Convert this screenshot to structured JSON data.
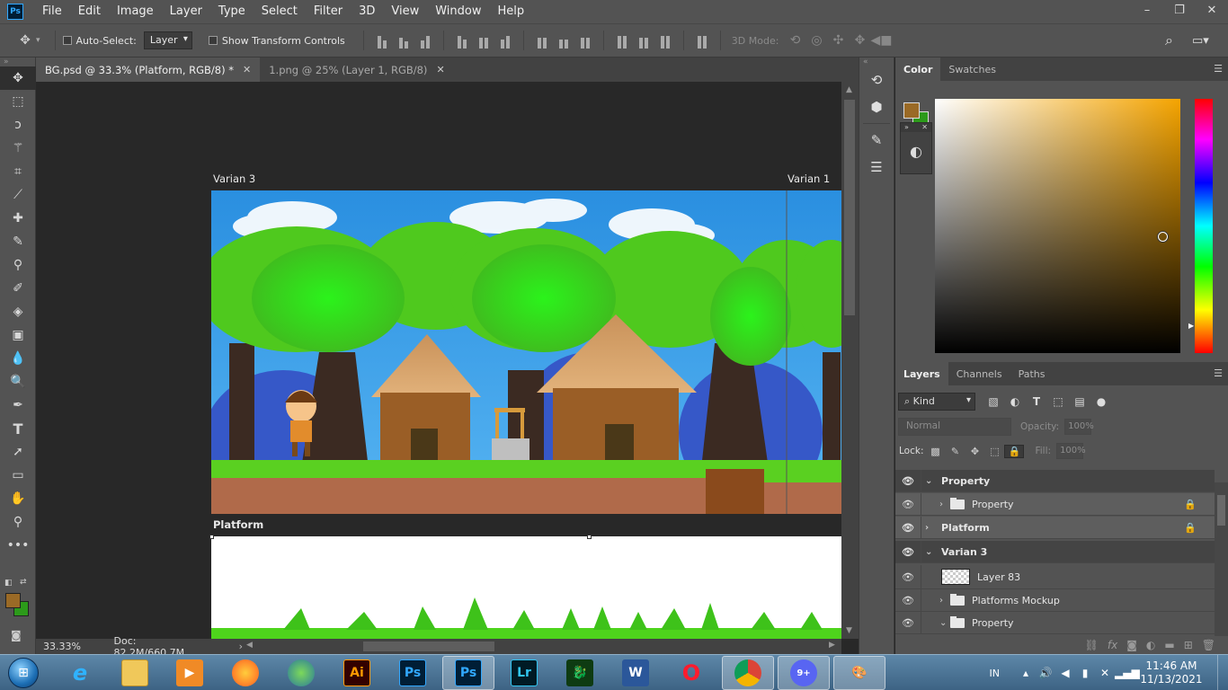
{
  "app": {
    "logo_text": "Ps",
    "menu": [
      "File",
      "Edit",
      "Image",
      "Layer",
      "Type",
      "Select",
      "Filter",
      "3D",
      "View",
      "Window",
      "Help"
    ],
    "window_controls": [
      "minimize-icon",
      "restore-icon",
      "close-icon"
    ]
  },
  "options_bar": {
    "auto_select_label": "Auto-Select:",
    "auto_select_value": "Layer",
    "show_transform_label": "Show Transform Controls",
    "mode_3d_label": "3D Mode:"
  },
  "tools": [
    "move-icon",
    "marquee-icon",
    "lasso-icon",
    "magic-wand-icon",
    "crop-icon",
    "eyedropper-icon",
    "healing-brush-icon",
    "brush-icon",
    "clone-stamp-icon",
    "history-brush-icon",
    "eraser-icon",
    "gradient-icon",
    "blur-icon",
    "dodge-icon",
    "pen-icon",
    "type-icon",
    "path-selection-icon",
    "rectangle-icon",
    "hand-icon",
    "zoom-icon",
    "more-tools-icon"
  ],
  "colors": {
    "foreground": "#9a6a26",
    "background": "#2c9a1a",
    "accent": "#31a8ff"
  },
  "tabs": [
    {
      "label": "BG.psd @ 33.3% (Platform, RGB/8) *",
      "active": true
    },
    {
      "label": "1.png @ 25% (Layer 1, RGB/8)",
      "active": false
    }
  ],
  "canvas": {
    "artboard_left_label": "Varian 3",
    "artboard_right_label": "Varian 1",
    "platform_label": "Platform"
  },
  "status": {
    "zoom": "33.33%",
    "doc_size": "Doc: 82.2M/660.7M"
  },
  "color_panel": {
    "tabs": [
      "Color",
      "Swatches"
    ]
  },
  "layers_panel": {
    "tabs": [
      "Layers",
      "Channels",
      "Paths"
    ],
    "filter_kind": "Kind",
    "blend_mode": "Normal",
    "opacity_label": "Opacity:",
    "opacity_value": "100%",
    "lock_label": "Lock:",
    "fill_label": "Fill:",
    "fill_value": "100%",
    "layers": [
      {
        "name": "Property",
        "type": "group",
        "expanded": true,
        "indent": 0,
        "locked": false
      },
      {
        "name": "Property",
        "type": "folder",
        "expanded": false,
        "indent": 1,
        "locked": true
      },
      {
        "name": "Platform",
        "type": "group",
        "expanded": false,
        "indent": 0,
        "locked": true,
        "selected": true
      },
      {
        "name": "Varian 3",
        "type": "group",
        "expanded": true,
        "indent": 0,
        "locked": false
      },
      {
        "name": "Layer 83",
        "type": "layer",
        "indent": 1,
        "locked": false
      },
      {
        "name": "Platforms Mockup",
        "type": "folder",
        "expanded": false,
        "indent": 1,
        "locked": false
      },
      {
        "name": "Property",
        "type": "folder",
        "expanded": true,
        "indent": 1,
        "locked": false
      }
    ]
  },
  "taskbar": {
    "apps": [
      {
        "name": "internet-explorer",
        "label": "e"
      },
      {
        "name": "file-explorer",
        "label": ""
      },
      {
        "name": "media-player",
        "label": "▶"
      },
      {
        "name": "firefox",
        "label": ""
      },
      {
        "name": "internet-download-manager",
        "label": ""
      },
      {
        "name": "illustrator",
        "label": "Ai"
      },
      {
        "name": "photoshop-1",
        "label": "Ps"
      },
      {
        "name": "photoshop-2",
        "label": "Ps"
      },
      {
        "name": "lightroom",
        "label": "Lr"
      },
      {
        "name": "dragon-app",
        "label": "🐉"
      },
      {
        "name": "word",
        "label": "W"
      },
      {
        "name": "opera",
        "label": "O"
      },
      {
        "name": "chrome",
        "label": ""
      },
      {
        "name": "discord",
        "label": "9+"
      },
      {
        "name": "paint",
        "label": "🎨"
      }
    ],
    "language": "IN",
    "time": "11:46 AM",
    "date": "11/13/2021"
  }
}
